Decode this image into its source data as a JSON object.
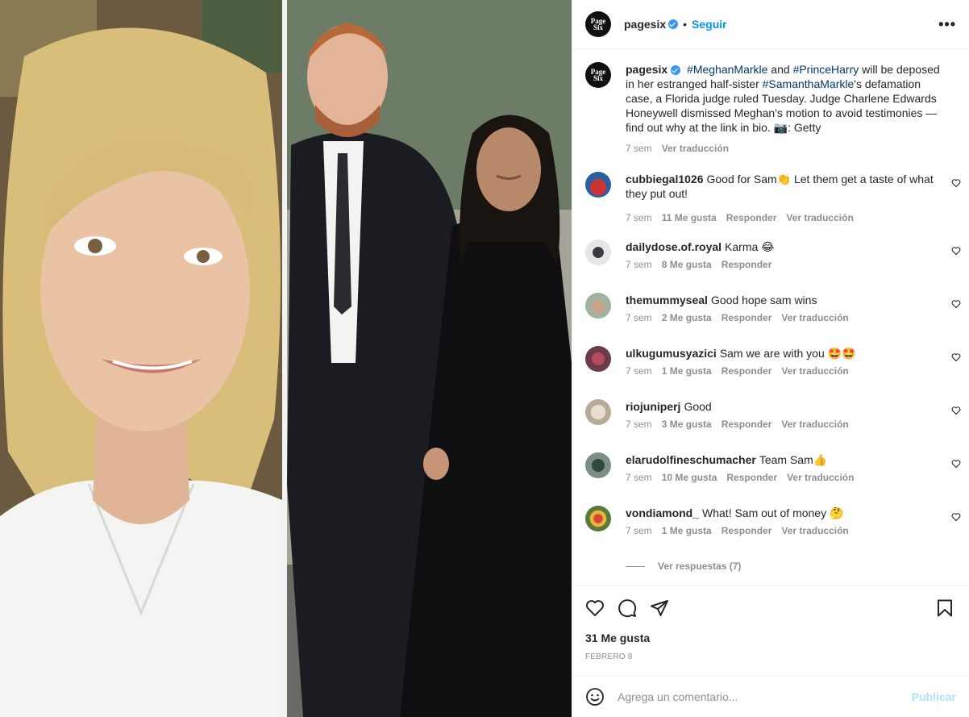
{
  "post": {
    "account": "pagesix",
    "logo_text": "Page Six",
    "follow_label": "Seguir",
    "more_label": "•••",
    "caption": {
      "username": "pagesix",
      "tag1": "#MeghanMarkle",
      "t1": " and ",
      "tag2": "#PrinceHarry",
      "t2": " will be deposed in her estranged half-sister ",
      "tag3": "#SamanthaMarkle",
      "t3": "'s defamation case, a Florida judge ruled Tuesday. Judge Charlene Edwards Honeywell dismissed Meghan's motion to avoid testimonies — find out why at the link in bio. 📷: Getty",
      "time": "7 sem",
      "translate": "Ver traducción"
    },
    "likes_label": "31 Me gusta",
    "date_label": "FEBRERO 8",
    "view_replies_label": "Ver respuestas (7)",
    "comment_placeholder": "Agrega un comentario...",
    "publish_label": "Publicar"
  },
  "comments": [
    {
      "user": "cubbiegal1026",
      "text": "Good for Sam👏 Let them get a taste of what they put out!",
      "time": "7 sem",
      "likes": "11 Me gusta",
      "reply": "Responder",
      "translate": "Ver traducción"
    },
    {
      "user": "dailydose.of.royal",
      "text": "Karma 😂",
      "time": "7 sem",
      "likes": "8 Me gusta",
      "reply": "Responder"
    },
    {
      "user": "themummyseal",
      "text": "Good hope sam wins",
      "time": "7 sem",
      "likes": "2 Me gusta",
      "reply": "Responder",
      "translate": "Ver traducción"
    },
    {
      "user": "ulkugumusyazici",
      "text": "Sam we are with you 🤩🤩",
      "time": "7 sem",
      "likes": "1 Me gusta",
      "reply": "Responder",
      "translate": "Ver traducción"
    },
    {
      "user": "riojuniperj",
      "text": "Good",
      "time": "7 sem",
      "likes": "3 Me gusta",
      "reply": "Responder",
      "translate": "Ver traducción"
    },
    {
      "user": "elarudolfineschumacher",
      "text": "Team Sam👍",
      "time": "7 sem",
      "likes": "10 Me gusta",
      "reply": "Responder",
      "translate": "Ver traducción"
    },
    {
      "user": "vondiamond_",
      "text": "What! Sam out of money 🤔",
      "time": "7 sem",
      "likes": "1 Me gusta",
      "reply": "Responder",
      "translate": "Ver traducción"
    }
  ],
  "colors": {
    "accent": "#0095f6",
    "link": "#00376b",
    "muted": "#8e8e8e",
    "publish_disabled": "#b2dffc"
  },
  "icons": [
    "verified-badge-icon",
    "more-options-icon",
    "heart-icon",
    "comment-icon",
    "share-icon",
    "bookmark-icon",
    "emoji-icon"
  ]
}
